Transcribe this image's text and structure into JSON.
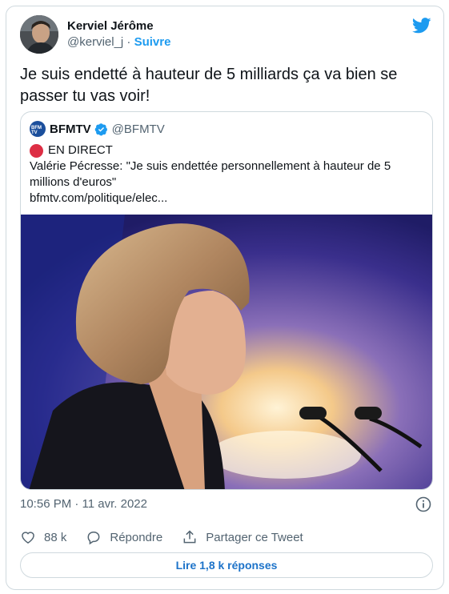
{
  "author": {
    "name": "Kerviel Jérôme",
    "handle": "@kerviel_j",
    "separator": " · ",
    "follow_label": "Suivre"
  },
  "tweet": {
    "text": "Je suis endetté à hauteur de 5 milliards ça va bien se passer tu vas voir!"
  },
  "quoted": {
    "name": "BFMTV",
    "logo_text": "BFM TV",
    "handle": "@BFMTV",
    "live_label": "EN DIRECT",
    "text": "Valérie Pécresse: \"Je suis endettée personnellement à hauteur de 5 millions d'euros\"",
    "link": "bfmtv.com/politique/elec..."
  },
  "meta": {
    "timestamp": "10:56 PM · 11 avr. 2022"
  },
  "actions": {
    "likes": "88 k",
    "reply_label": "Répondre",
    "share_label": "Partager ce Tweet"
  },
  "replies_button": "Lire 1,8 k réponses",
  "colors": {
    "twitter_blue": "#1d9bf0",
    "live_red": "#dd2e44",
    "border": "#cfd9de",
    "secondary_text": "#536471"
  },
  "icons": [
    "twitter-bird-icon",
    "verified-badge-icon",
    "live-dot-icon",
    "info-icon",
    "heart-icon",
    "reply-icon",
    "share-icon"
  ]
}
